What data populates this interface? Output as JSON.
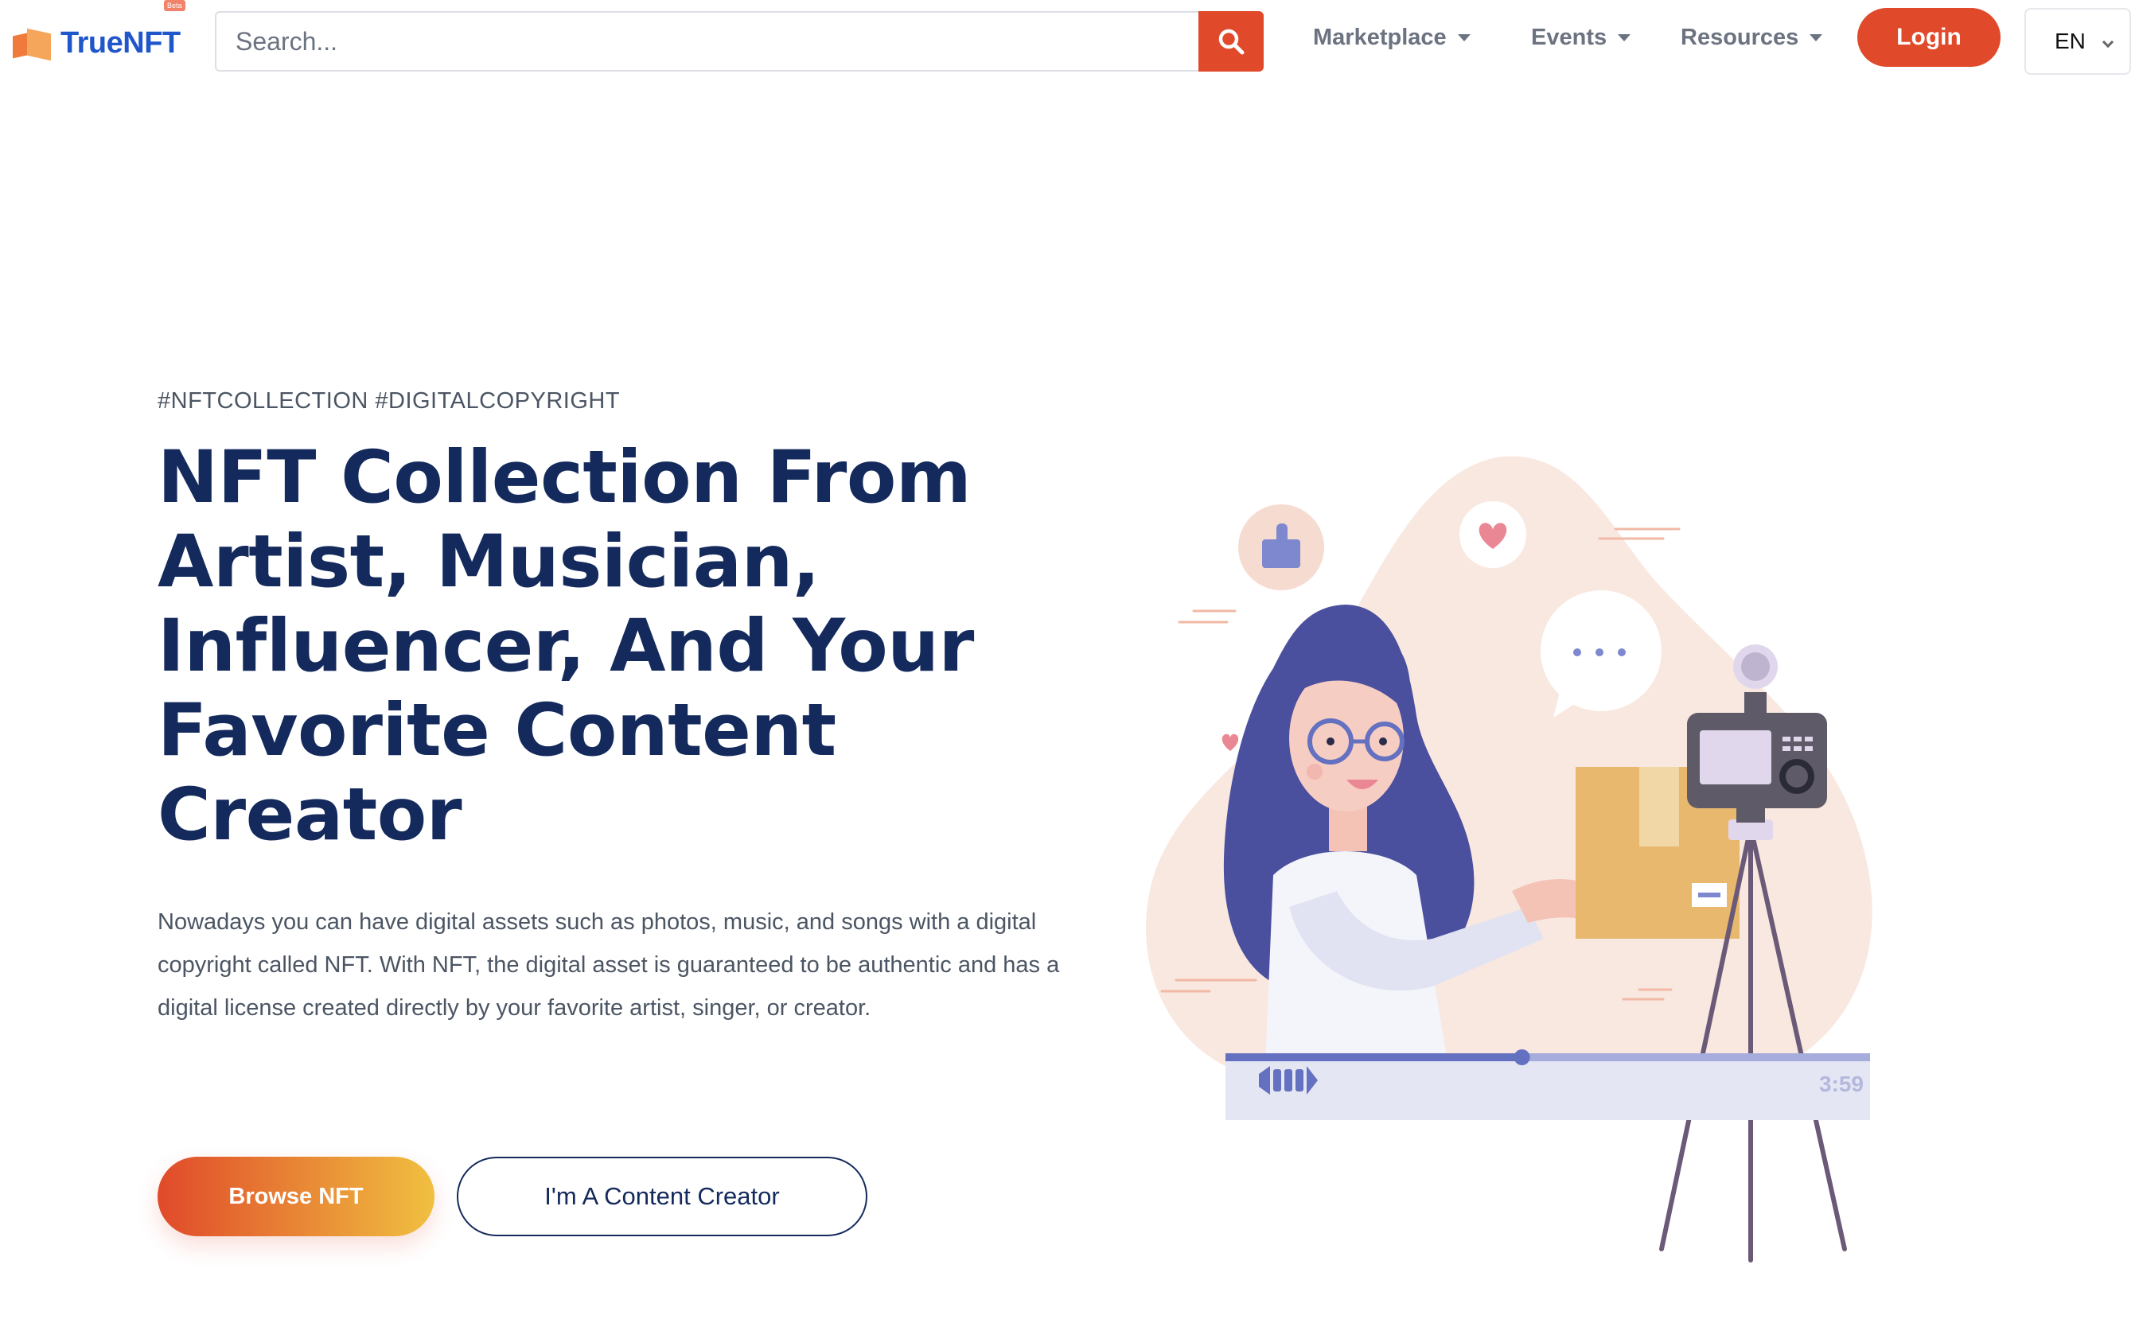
{
  "header": {
    "logo_text": "TrueNFT",
    "logo_badge": "Beta",
    "search_placeholder": "Search...",
    "nav": [
      {
        "label": "Marketplace"
      },
      {
        "label": "Events"
      },
      {
        "label": "Resources"
      }
    ],
    "login_label": "Login",
    "language": "EN"
  },
  "hero": {
    "tags": "#NFTCOLLECTION #DIGITALCOPYRIGHT",
    "title_lines": [
      "NFT Collection From",
      "Artist, Musician,",
      "Influencer, And Your",
      "Favorite Content",
      "Creator"
    ],
    "description": "Nowadays you can have digital assets such as photos, music, and songs with a digital copyright called NFT. With NFT, the digital asset is guaranteed to be authentic and has a digital license created directly by your favorite artist, singer, or creator.",
    "primary_button": "Browse NFT",
    "secondary_button": "I'm A Content Creator"
  },
  "illustration": {
    "video_time": "3:59",
    "video_progress": 0.46,
    "colors": {
      "blob": "#f9e8e0",
      "hair": "#4a4f9e",
      "box": "#e9b86f",
      "camera": "#5f5a68",
      "tripod": "#6a5a78",
      "bar_track": "#e4e6f4",
      "bar_progress": "#6470c0"
    }
  },
  "colors": {
    "brand_orange": "#e04a2a",
    "navy": "#142a5c",
    "logo_blue": "#1f56c9"
  }
}
